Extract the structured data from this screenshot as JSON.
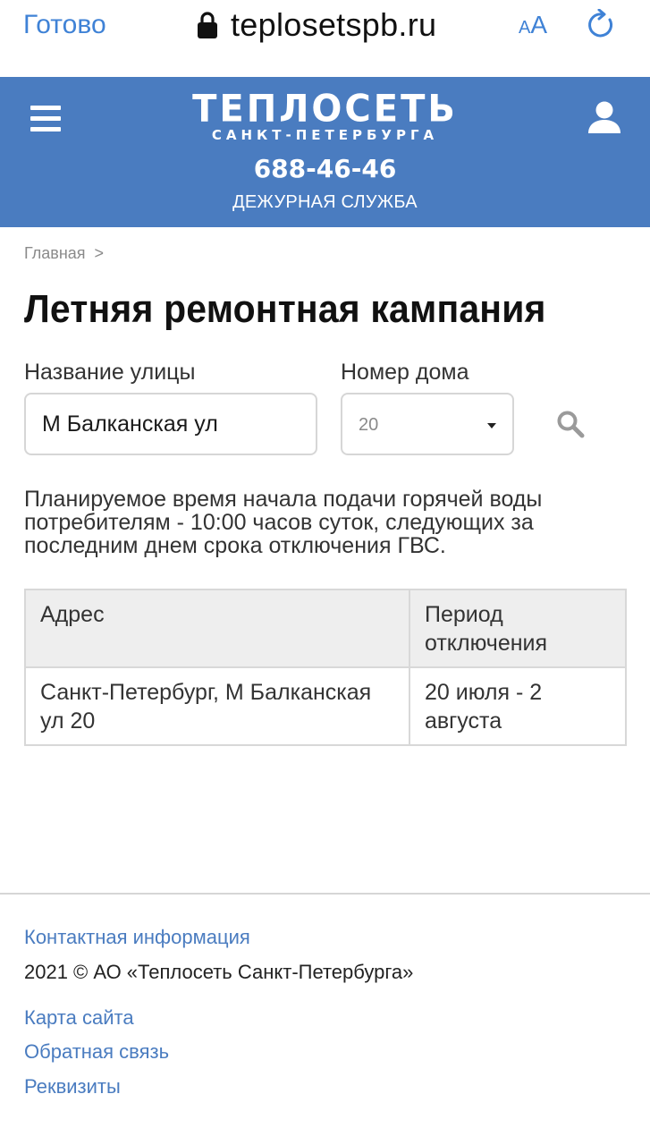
{
  "browser": {
    "done_label": "Готово",
    "url": "teplosetspb.ru",
    "text_size_small": "A",
    "text_size_big": "A"
  },
  "header": {
    "logo_main": "ТЕПЛОСЕТЬ",
    "logo_sub": "САНКТ-ПЕТЕРБУРГА",
    "phone": "688-46-46",
    "duty_label": "ДЕЖУРНАЯ СЛУЖБА",
    "bg_color": "#4a7cc0",
    "icons": {
      "menu": "hamburger-menu-icon",
      "user": "user-profile-icon"
    }
  },
  "breadcrumb": {
    "home": "Главная",
    "separator": ">"
  },
  "page": {
    "title": "Летняя ремонтная кампания"
  },
  "form": {
    "street_label": "Название улицы",
    "street_value": "М Балканская ул",
    "house_label": "Номер дома",
    "house_value": "20"
  },
  "info": {
    "text": "Планируемое время начала подачи горячей воды потребителям - 10:00 часов суток, следующих за последним днем срока отключения ГВС."
  },
  "table": {
    "headers": [
      "Адрес",
      "Период отключения"
    ],
    "rows": [
      [
        "Санкт-Петербург, М Балканская ул 20",
        "20 июля - 2 августа"
      ]
    ]
  },
  "footer": {
    "contact": "Контактная информация",
    "copyright": "2021 © АО «Теплосеть Санкт-Петербурга»",
    "sitemap": "Карта сайта",
    "feedback": "Обратная связь",
    "requisites": "Реквизиты",
    "link_color": "#4a7cc0"
  }
}
